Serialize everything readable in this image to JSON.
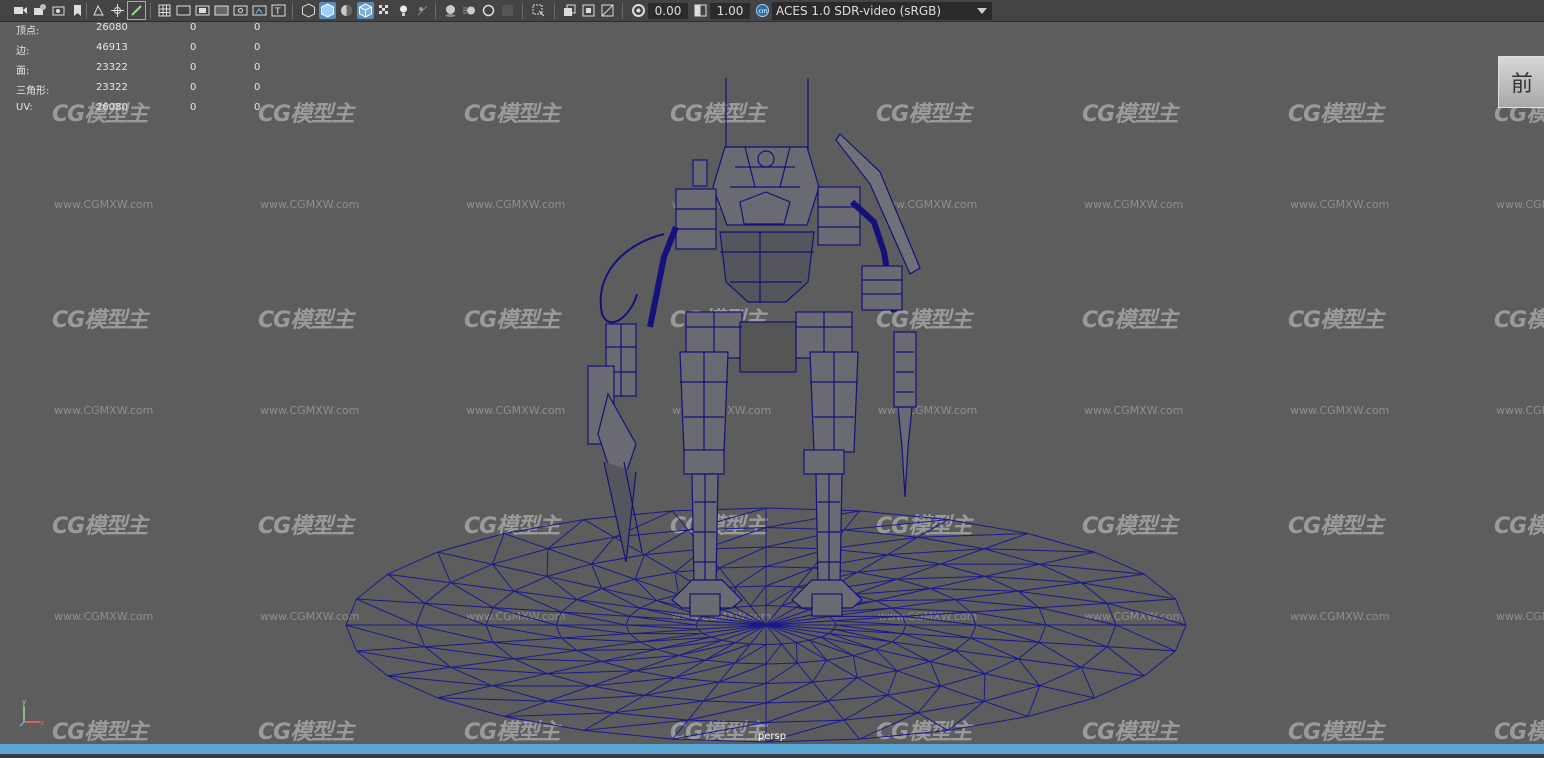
{
  "toolbar": {
    "exposure_value": "0.00",
    "gamma_value": "1.00",
    "color_space": "ACES 1.0 SDR-video (sRGB)"
  },
  "hud": {
    "rows": [
      {
        "label": "顶点:",
        "value": "26080",
        "sel": "0",
        "extra": "0"
      },
      {
        "label": "边:",
        "value": "46913",
        "sel": "0",
        "extra": "0"
      },
      {
        "label": "面:",
        "value": "23322",
        "sel": "0",
        "extra": "0"
      },
      {
        "label": "三角形:",
        "value": "23322",
        "sel": "0",
        "extra": "0"
      },
      {
        "label": "UV:",
        "value": "26080",
        "sel": "0",
        "extra": "0"
      }
    ]
  },
  "viewport": {
    "camera_label": "persp",
    "view_cube_label": "前",
    "watermark_logo": "CG模型主",
    "watermark_url": "www.CGMXW.com",
    "wireframe_color": "#1a1a8c",
    "background_color": "#5d5d5d"
  },
  "colors": {
    "toolbar_bg": "#444444",
    "accent_blue": "#5aa7d6",
    "active_icon": "#5c8db8"
  }
}
